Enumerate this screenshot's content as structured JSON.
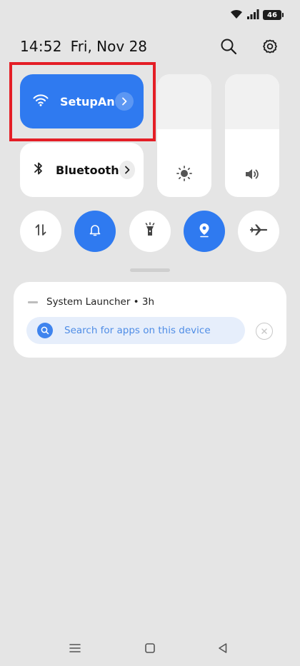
{
  "status_bar": {
    "battery_level": "46",
    "icons": [
      "wifi-signal-icon",
      "cellular-signal-icon",
      "battery-icon"
    ]
  },
  "header": {
    "time": "14:52",
    "date": "Fri, Nov 28",
    "icons": [
      "search-icon",
      "gear-icon"
    ]
  },
  "tiles": {
    "wifi": {
      "label": "SetupAn..",
      "state": "on",
      "icon": "wifi-icon"
    },
    "bluetooth": {
      "label": "Bluetooth",
      "state": "off",
      "icon": "bluetooth-icon"
    }
  },
  "sliders": {
    "brightness": {
      "level": 0.55,
      "icon": "brightness-icon"
    },
    "volume": {
      "level": 0.55,
      "icon": "volume-icon"
    }
  },
  "toggles": [
    {
      "name": "mobile-data",
      "icon": "data-transfer-icon",
      "state": "off"
    },
    {
      "name": "sound",
      "icon": "bell-icon",
      "state": "on"
    },
    {
      "name": "flashlight",
      "icon": "flashlight-icon",
      "state": "off"
    },
    {
      "name": "location",
      "icon": "location-pin-icon",
      "state": "on"
    },
    {
      "name": "airplane-mode",
      "icon": "airplane-icon",
      "state": "off"
    }
  ],
  "notification": {
    "app": "System Launcher",
    "age": "3h",
    "title": "System Launcher • 3h",
    "search_placeholder": "Search for apps on this device"
  },
  "nav": {
    "icons": [
      "menu-icon",
      "home-icon",
      "back-icon"
    ]
  },
  "colors": {
    "accent": "#2f7af0",
    "highlight_box": "#e41e26",
    "background": "#e5e5e5"
  }
}
